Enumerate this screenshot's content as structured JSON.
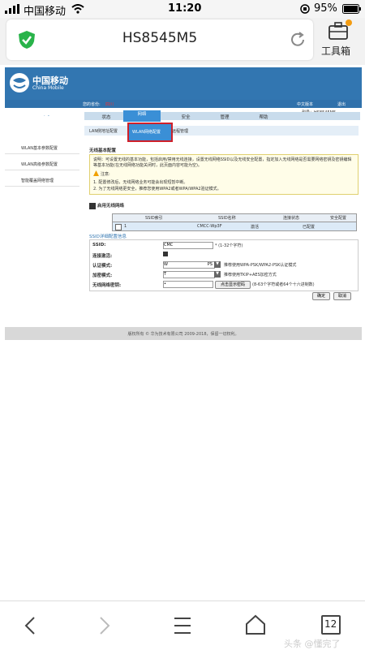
{
  "statusbar": {
    "carrier": "中国移动",
    "time": "11:20",
    "battery": "95%"
  },
  "browser": {
    "url": "HS8545M5",
    "toolbox_label": "工具箱"
  },
  "router": {
    "logo_cn": "中国移动",
    "logo_en": "China Mobile",
    "user_label": "您的省份:",
    "user_value": "四川",
    "model_label": "型号：HS8545M5",
    "lang_label": "中文版本",
    "logout": "退出",
    "section_title": "网络",
    "tabs": [
      "状态",
      "网络",
      "安全",
      "管理",
      "帮助"
    ],
    "subnav": [
      "LAN侧地址配置",
      "WLAN网络配置",
      "远程管理"
    ],
    "sidebar": [
      "WLAN基本参数配置",
      "WLAN高级参数配置",
      "智能覆盖网络管理"
    ],
    "basic_title": "无线基本配置",
    "info_text": "说明：可设置无线的基本功能，包括启用/禁用无线连接，设置无线网络SSID以及无线安全配置，指定加入无线网络是否需要网络密钥及密钥编辑等基本功能(在无线网络功能关闭时，此页面内容可能为空)。",
    "note_label": "注意:",
    "notes": [
      "1. 配置修改后，无线网络业务可能会出现短暂中断。",
      "2. 为了无线网络更安全，推荐您使用WPA2或者WPA/WPA2验证模式。"
    ],
    "enable_label": "启用无线网络",
    "table_headers": [
      "SSID索引",
      "SSID名称",
      "连接状态",
      "安全配置"
    ],
    "table_row": {
      "index": "1",
      "name": "CMCC-Wp3F",
      "status": "激活",
      "security": "已配置"
    },
    "detail_title": "SSID详细配置信息",
    "fields": {
      "ssid_label": "SSID:",
      "ssid_value": "CMC",
      "ssid_hint": "* (1-32个字符)",
      "enable_label": "连接激活:",
      "auth_label": "认证模式:",
      "auth_value": "W",
      "auth_tail": "PS",
      "auth_hint": "推荐使用WPA-PSK/WPA2-PSK认证模式",
      "enc_label": "加密模式:",
      "enc_value": "T",
      "enc_hint": "推荐使用TKIP+AES加密方式",
      "key_label": "无线网络密钥:",
      "key_value": "•",
      "key_show_btn": "点击显示密码",
      "key_hint": "(8-63个字符或者64个十六进制数)"
    },
    "confirm_btn": "确定",
    "cancel_btn": "取消",
    "footer": "版权所有 © 华为技术有限公司 2009-2018，保留一切权利。"
  },
  "nav": {
    "tabs_count": "12",
    "watermark": "头条 @懂完了"
  }
}
